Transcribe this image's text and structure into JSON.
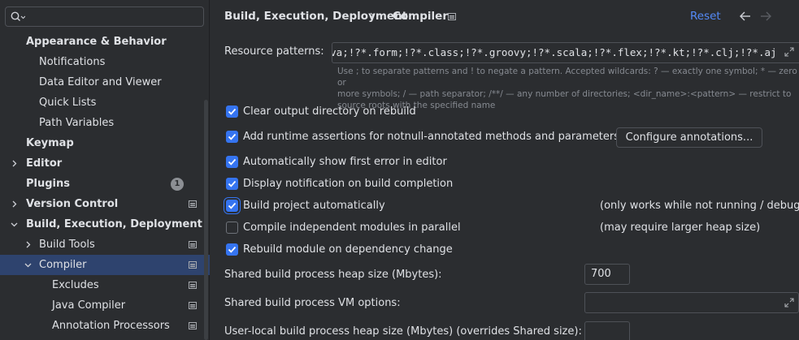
{
  "search": {
    "value": ""
  },
  "sidebar": {
    "items": [
      {
        "label": "Appearance & Behavior",
        "bold": true
      },
      {
        "label": "Notifications"
      },
      {
        "label": "Data Editor and Viewer"
      },
      {
        "label": "Quick Lists"
      },
      {
        "label": "Path Variables"
      },
      {
        "label": "Keymap",
        "bold": true
      },
      {
        "label": "Editor",
        "bold": true,
        "chevron": "collapsed"
      },
      {
        "label": "Plugins",
        "bold": true,
        "badge": "1"
      },
      {
        "label": "Version Control",
        "bold": true,
        "chevron": "collapsed"
      },
      {
        "label": "Build, Execution, Deployment",
        "bold": true,
        "chevron": "expanded"
      },
      {
        "label": "Build Tools",
        "chevron": "collapsed"
      },
      {
        "label": "Compiler",
        "chevron": "expanded",
        "selected": true
      },
      {
        "label": "Excludes"
      },
      {
        "label": "Java Compiler"
      },
      {
        "label": "Annotation Processors"
      }
    ]
  },
  "header": {
    "breadcrumb_parent": "Build, Execution, Deployment",
    "breadcrumb_current": "Compiler",
    "reset_label": "Reset"
  },
  "resource_patterns": {
    "label": "Resource patterns:",
    "value": "!?*.java;!?*.form;!?*.class;!?*.groovy;!?*.scala;!?*.flex;!?*.kt;!?*.clj;!?*.aj",
    "hint_line1": "Use ; to separate patterns and ! to negate a pattern. Accepted wildcards: ? — exactly one symbol; * — zero or",
    "hint_line2": "more symbols; / — path separator; /**/ — any number of directories; <dir_name>:<pattern> — restrict to",
    "hint_line3": "source roots with the specified name"
  },
  "options": {
    "clear_output": {
      "label": "Clear output directory on rebuild",
      "checked": true
    },
    "runtime_assertions": {
      "label": "Add runtime assertions for notnull-annotated methods and parameters",
      "checked": true
    },
    "configure_annotations": "Configure annotations...",
    "show_first_error": {
      "label": "Automatically show first error in editor",
      "checked": true
    },
    "display_notification": {
      "label": "Display notification on build completion",
      "checked": true
    },
    "build_automatically": {
      "label": "Build project automatically",
      "checked": true,
      "note": "(only works while not running / debugging)"
    },
    "compile_parallel": {
      "label": "Compile independent modules in parallel",
      "checked": false,
      "note": "(may require larger heap size)"
    },
    "rebuild_on_dependency": {
      "label": "Rebuild module on dependency change",
      "checked": true
    }
  },
  "heap": {
    "shared_label": "Shared build process heap size (Mbytes):",
    "shared_value": "700",
    "vm_label": "Shared build process VM options:",
    "vm_value": "",
    "user_label": "User-local build process heap size (Mbytes) (overrides Shared size):",
    "user_value": ""
  },
  "colors": {
    "accent": "#3574f0",
    "link": "#548af7",
    "selection": "#2e436e",
    "background": "#2b2d30"
  }
}
